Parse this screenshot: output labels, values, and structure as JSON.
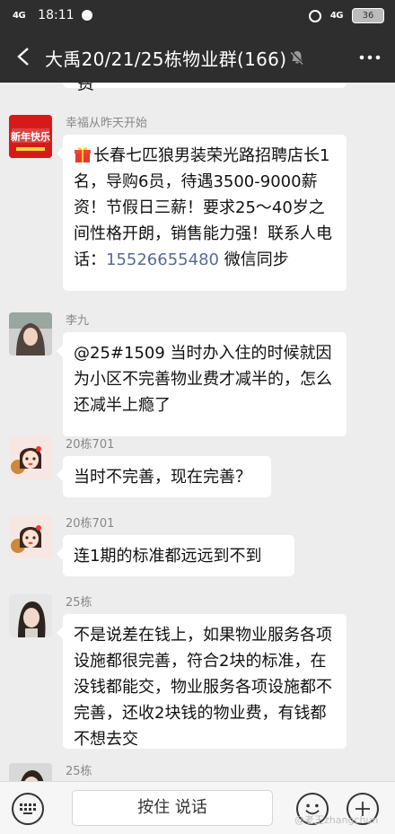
{
  "status_bar": {
    "signal": "4G",
    "time": "18:11",
    "network": "4G",
    "battery": "36"
  },
  "header": {
    "title": "大禹20/21/25栋物业群(166)"
  },
  "previous_message_tail": "费",
  "messages": [
    {
      "sender": "幸福从昨天开始",
      "text_before_phone": "长春七匹狼男装荣光路招聘店长1名，导购6员，待遇3500-9000薪资！节假日三薪！要求25～40岁之间性格开朗，销售能力强！联系人电话：",
      "phone": "15526655480",
      "text_after_phone": " 微信同步",
      "avatar_text": "新年快乐"
    },
    {
      "sender": "李九",
      "text": "@25#1509 当时办入住的时候就因为小区不完善物业费才减半的，怎么还减半上瘾了"
    },
    {
      "sender": "20栋701",
      "text": "当时不完善，现在完善？"
    },
    {
      "sender": "20栋701",
      "text": "连1期的标准都远远到不到"
    },
    {
      "sender": "25栋",
      "text": "不是说差在钱上，如果物业服务各项设施都很完善，符合2块的标准，在没钱都能交，物业服务各项设施都不完善，还收2块钱的物业费，有钱都不想去交"
    },
    {
      "sender": "25栋"
    }
  ],
  "input_bar": {
    "hold_to_talk": "按住 说话"
  },
  "watermark": "@老王zhangchun",
  "colors": {
    "topbar": "#2e2e2e",
    "chat_bg": "#ededed",
    "link": "#576b95"
  }
}
